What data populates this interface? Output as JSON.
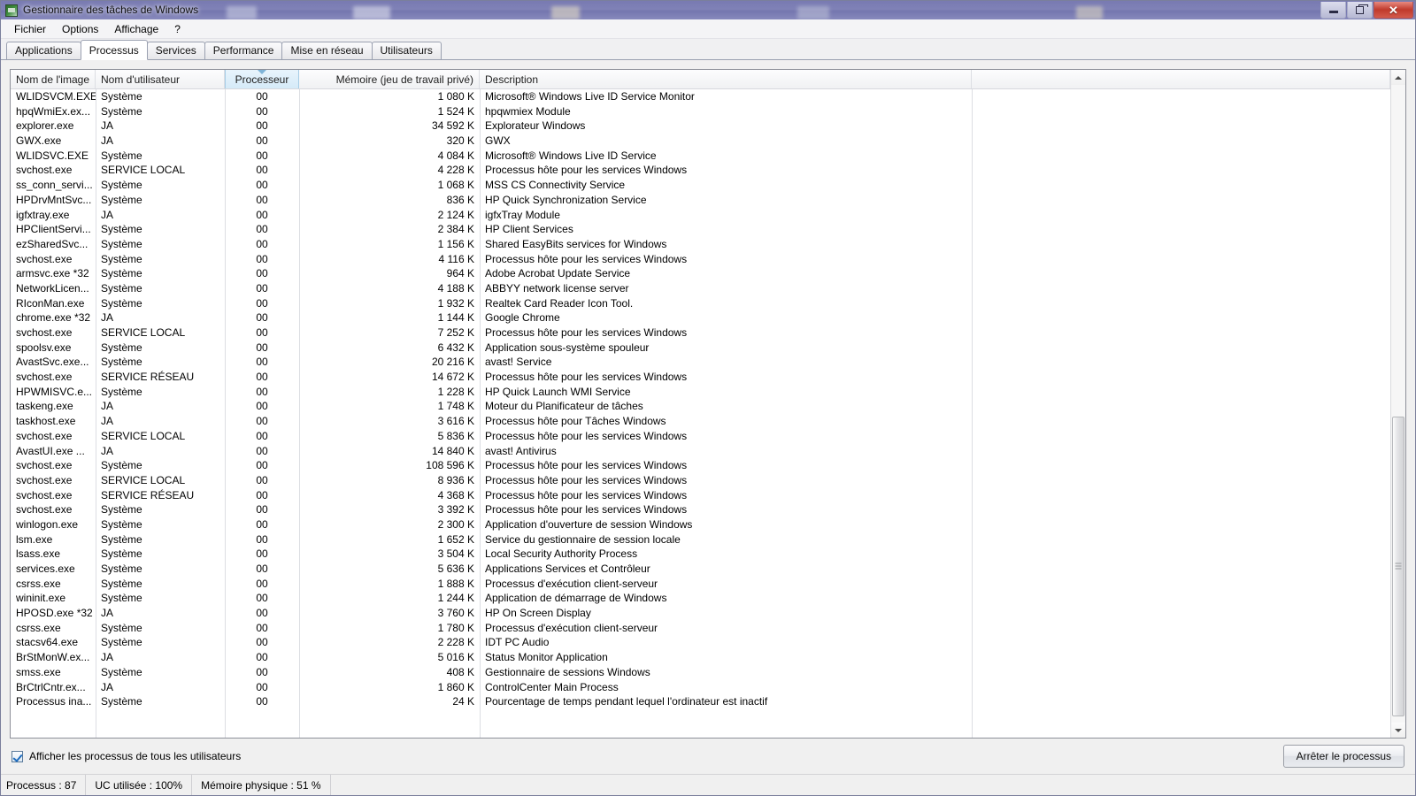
{
  "window": {
    "title": "Gestionnaire des tâches de Windows",
    "icon": "task-manager-icon",
    "minimize_label": "",
    "maximize_label": "",
    "close_label": "✕"
  },
  "menu": {
    "items": [
      {
        "label": "Fichier"
      },
      {
        "label": "Options"
      },
      {
        "label": "Affichage"
      },
      {
        "label": "?"
      }
    ]
  },
  "tabs": [
    {
      "label": "Applications",
      "active": false
    },
    {
      "label": "Processus",
      "active": true
    },
    {
      "label": "Services",
      "active": false
    },
    {
      "label": "Performance",
      "active": false
    },
    {
      "label": "Mise en réseau",
      "active": false
    },
    {
      "label": "Utilisateurs",
      "active": false
    }
  ],
  "table": {
    "columns": [
      {
        "key": "name",
        "label": "Nom de l'image",
        "align": "left",
        "sorted": false
      },
      {
        "key": "user",
        "label": "Nom d'utilisateur",
        "align": "left",
        "sorted": false
      },
      {
        "key": "cpu",
        "label": "Processeur",
        "align": "center",
        "sorted": true
      },
      {
        "key": "mem",
        "label": "Mémoire (jeu de travail privé)",
        "align": "right",
        "sorted": false
      },
      {
        "key": "desc",
        "label": "Description",
        "align": "left",
        "sorted": false
      }
    ],
    "sort_direction": "descending",
    "rows": [
      {
        "name": "WLIDSVCM.EXE",
        "user": "Système",
        "cpu": "00",
        "mem": "1 080 K",
        "desc": "Microsoft® Windows Live ID Service Monitor"
      },
      {
        "name": "hpqWmiEx.ex...",
        "user": "Système",
        "cpu": "00",
        "mem": "1 524 K",
        "desc": "hpqwmiex Module"
      },
      {
        "name": "explorer.exe",
        "user": "JA",
        "cpu": "00",
        "mem": "34 592 K",
        "desc": "Explorateur Windows"
      },
      {
        "name": "GWX.exe",
        "user": "JA",
        "cpu": "00",
        "mem": "320 K",
        "desc": "GWX"
      },
      {
        "name": "WLIDSVC.EXE",
        "user": "Système",
        "cpu": "00",
        "mem": "4 084 K",
        "desc": "Microsoft® Windows Live ID Service"
      },
      {
        "name": "svchost.exe",
        "user": "SERVICE LOCAL",
        "cpu": "00",
        "mem": "4 228 K",
        "desc": "Processus hôte pour les services Windows"
      },
      {
        "name": "ss_conn_servi...",
        "user": "Système",
        "cpu": "00",
        "mem": "1 068 K",
        "desc": "MSS CS Connectivity Service"
      },
      {
        "name": "HPDrvMntSvc...",
        "user": "Système",
        "cpu": "00",
        "mem": "836 K",
        "desc": "HP Quick Synchronization Service"
      },
      {
        "name": "igfxtray.exe",
        "user": "JA",
        "cpu": "00",
        "mem": "2 124 K",
        "desc": "igfxTray Module"
      },
      {
        "name": "HPClientServi...",
        "user": "Système",
        "cpu": "00",
        "mem": "2 384 K",
        "desc": "HP Client Services"
      },
      {
        "name": "ezSharedSvc...",
        "user": "Système",
        "cpu": "00",
        "mem": "1 156 K",
        "desc": "Shared EasyBits services for Windows"
      },
      {
        "name": "svchost.exe",
        "user": "Système",
        "cpu": "00",
        "mem": "4 116 K",
        "desc": "Processus hôte pour les services Windows"
      },
      {
        "name": "armsvc.exe *32",
        "user": "Système",
        "cpu": "00",
        "mem": "964 K",
        "desc": "Adobe Acrobat Update Service"
      },
      {
        "name": "NetworkLicen...",
        "user": "Système",
        "cpu": "00",
        "mem": "4 188 K",
        "desc": "ABBYY network license server"
      },
      {
        "name": "RIconMan.exe",
        "user": "Système",
        "cpu": "00",
        "mem": "1 932 K",
        "desc": "Realtek Card Reader Icon Tool."
      },
      {
        "name": "chrome.exe *32",
        "user": "JA",
        "cpu": "00",
        "mem": "1 144 K",
        "desc": "Google Chrome"
      },
      {
        "name": "svchost.exe",
        "user": "SERVICE LOCAL",
        "cpu": "00",
        "mem": "7 252 K",
        "desc": "Processus hôte pour les services Windows"
      },
      {
        "name": "spoolsv.exe",
        "user": "Système",
        "cpu": "00",
        "mem": "6 432 K",
        "desc": "Application sous-système spouleur"
      },
      {
        "name": "AvastSvc.exe...",
        "user": "Système",
        "cpu": "00",
        "mem": "20 216 K",
        "desc": "avast! Service"
      },
      {
        "name": "svchost.exe",
        "user": "SERVICE RÉSEAU",
        "cpu": "00",
        "mem": "14 672 K",
        "desc": "Processus hôte pour les services Windows"
      },
      {
        "name": "HPWMISVC.e...",
        "user": "Système",
        "cpu": "00",
        "mem": "1 228 K",
        "desc": "HP Quick Launch WMI Service"
      },
      {
        "name": "taskeng.exe",
        "user": "JA",
        "cpu": "00",
        "mem": "1 748 K",
        "desc": "Moteur du Planificateur de tâches"
      },
      {
        "name": "taskhost.exe",
        "user": "JA",
        "cpu": "00",
        "mem": "3 616 K",
        "desc": "Processus hôte pour Tâches Windows"
      },
      {
        "name": "svchost.exe",
        "user": "SERVICE LOCAL",
        "cpu": "00",
        "mem": "5 836 K",
        "desc": "Processus hôte pour les services Windows"
      },
      {
        "name": "AvastUI.exe ...",
        "user": "JA",
        "cpu": "00",
        "mem": "14 840 K",
        "desc": "avast! Antivirus"
      },
      {
        "name": "svchost.exe",
        "user": "Système",
        "cpu": "00",
        "mem": "108 596 K",
        "desc": "Processus hôte pour les services Windows"
      },
      {
        "name": "svchost.exe",
        "user": "SERVICE LOCAL",
        "cpu": "00",
        "mem": "8 936 K",
        "desc": "Processus hôte pour les services Windows"
      },
      {
        "name": "svchost.exe",
        "user": "SERVICE RÉSEAU",
        "cpu": "00",
        "mem": "4 368 K",
        "desc": "Processus hôte pour les services Windows"
      },
      {
        "name": "svchost.exe",
        "user": "Système",
        "cpu": "00",
        "mem": "3 392 K",
        "desc": "Processus hôte pour les services Windows"
      },
      {
        "name": "winlogon.exe",
        "user": "Système",
        "cpu": "00",
        "mem": "2 300 K",
        "desc": "Application d'ouverture de session Windows"
      },
      {
        "name": "lsm.exe",
        "user": "Système",
        "cpu": "00",
        "mem": "1 652 K",
        "desc": "Service du gestionnaire de session locale"
      },
      {
        "name": "lsass.exe",
        "user": "Système",
        "cpu": "00",
        "mem": "3 504 K",
        "desc": "Local Security Authority Process"
      },
      {
        "name": "services.exe",
        "user": "Système",
        "cpu": "00",
        "mem": "5 636 K",
        "desc": "Applications Services et Contrôleur"
      },
      {
        "name": "csrss.exe",
        "user": "Système",
        "cpu": "00",
        "mem": "1 888 K",
        "desc": "Processus d'exécution client-serveur"
      },
      {
        "name": "wininit.exe",
        "user": "Système",
        "cpu": "00",
        "mem": "1 244 K",
        "desc": "Application de démarrage de Windows"
      },
      {
        "name": "HPOSD.exe *32",
        "user": "JA",
        "cpu": "00",
        "mem": "3 760 K",
        "desc": "HP On Screen Display"
      },
      {
        "name": "csrss.exe",
        "user": "Système",
        "cpu": "00",
        "mem": "1 780 K",
        "desc": "Processus d'exécution client-serveur"
      },
      {
        "name": "stacsv64.exe",
        "user": "Système",
        "cpu": "00",
        "mem": "2 228 K",
        "desc": "IDT PC Audio"
      },
      {
        "name": "BrStMonW.ex...",
        "user": "JA",
        "cpu": "00",
        "mem": "5 016 K",
        "desc": "Status Monitor Application"
      },
      {
        "name": "smss.exe",
        "user": "Système",
        "cpu": "00",
        "mem": "408 K",
        "desc": "Gestionnaire de sessions Windows"
      },
      {
        "name": "BrCtrlCntr.ex...",
        "user": "JA",
        "cpu": "00",
        "mem": "1 860 K",
        "desc": "ControlCenter Main Process"
      },
      {
        "name": "Processus ina...",
        "user": "Système",
        "cpu": "00",
        "mem": "24 K",
        "desc": "Pourcentage de temps pendant lequel l'ordinateur est inactif"
      }
    ]
  },
  "footer": {
    "show_all_users_label": "Afficher les processus de tous les utilisateurs",
    "show_all_users_checked": true,
    "end_process_label": "Arrêter le processus"
  },
  "statusbar": {
    "processes": "Processus : 87",
    "cpu_usage": "UC utilisée : 100%",
    "physical_memory": "Mémoire physique : 51 %"
  },
  "colors": {
    "titlebar": "#6e70ac",
    "sorted_column": "#d5eaf8",
    "close_button": "#c03a2c",
    "accent": "#1d6bbd"
  }
}
